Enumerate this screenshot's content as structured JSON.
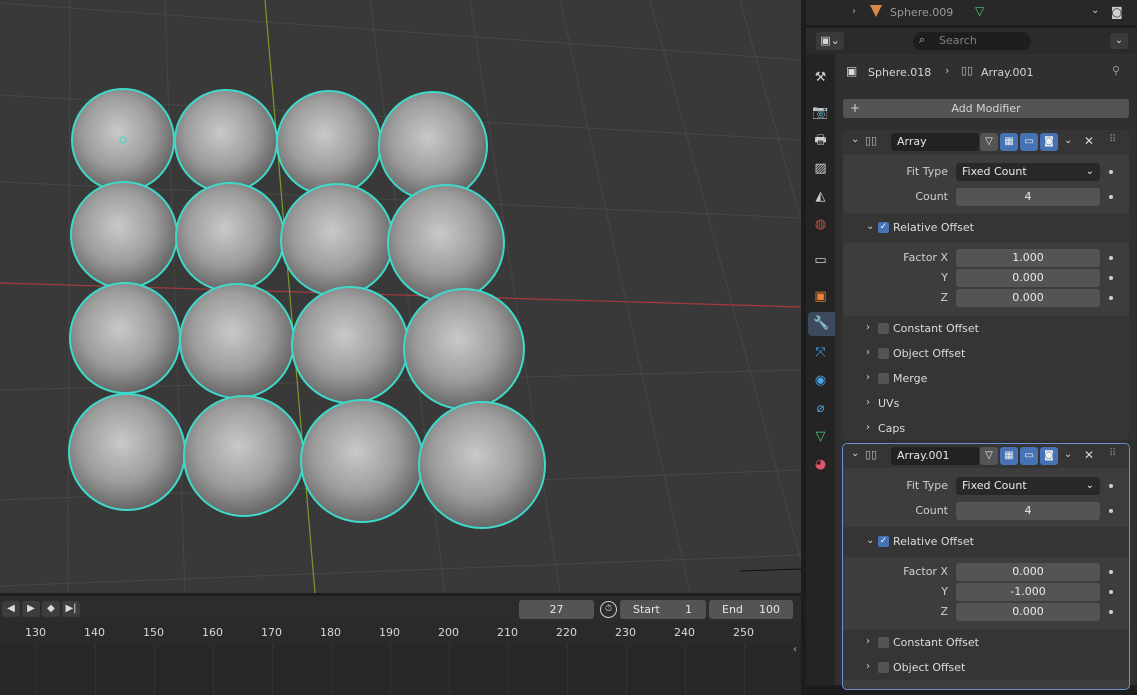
{
  "outliner": {
    "object_name": "Sphere.009"
  },
  "properties": {
    "search_placeholder": "Search",
    "breadcrumb": {
      "object": "Sphere.018",
      "modifier": "Array.001"
    },
    "add_modifier_label": "Add Modifier"
  },
  "modifiers": [
    {
      "name": "Array",
      "fit_type_label": "Fit Type",
      "fit_type": "Fixed Count",
      "count_label": "Count",
      "count": "4",
      "relative_offset_label": "Relative Offset",
      "factor_x_label": "Factor X",
      "factor_x": "1.000",
      "y_label": "Y",
      "factor_y": "0.000",
      "z_label": "Z",
      "factor_z": "0.000",
      "constant_offset": "Constant Offset",
      "object_offset": "Object Offset",
      "merge": "Merge",
      "uvs": "UVs",
      "caps": "Caps"
    },
    {
      "name": "Array.001",
      "fit_type_label": "Fit Type",
      "fit_type": "Fixed Count",
      "count_label": "Count",
      "count": "4",
      "relative_offset_label": "Relative Offset",
      "factor_x_label": "Factor X",
      "factor_x": "0.000",
      "y_label": "Y",
      "factor_y": "-1.000",
      "z_label": "Z",
      "factor_z": "0.000",
      "constant_offset": "Constant Offset",
      "object_offset": "Object Offset"
    }
  ],
  "timeline": {
    "current_frame": "27",
    "start_label": "Start",
    "start": "1",
    "end_label": "End",
    "end": "100",
    "ticks": [
      "130",
      "140",
      "150",
      "160",
      "170",
      "180",
      "190",
      "200",
      "210",
      "220",
      "230",
      "240",
      "250"
    ]
  },
  "colors": {
    "selection_outline": "#3fd9c9",
    "accent": "#4772b3",
    "x_axis": "#c0393b",
    "y_axis": "#6b8e23"
  },
  "icons": [
    "chevron-right-icon",
    "cone-icon",
    "mesh-icon",
    "chevron-down-icon",
    "camera-icon",
    "editor-type-icon",
    "search-icon",
    "object-icon",
    "modifier-icon",
    "pin-icon",
    "plus-icon",
    "filter-icon",
    "edit-mode-icon",
    "viewport-icon",
    "render-icon",
    "close-icon",
    "drag-icon",
    "tool-icon",
    "render-props-icon",
    "output-icon",
    "view-layer-icon",
    "scene-icon",
    "world-icon",
    "collection-icon",
    "physics-icon",
    "constraints-icon",
    "data-icon",
    "material-icon",
    "particles-icon",
    "play-icon",
    "stopwatch-icon"
  ]
}
